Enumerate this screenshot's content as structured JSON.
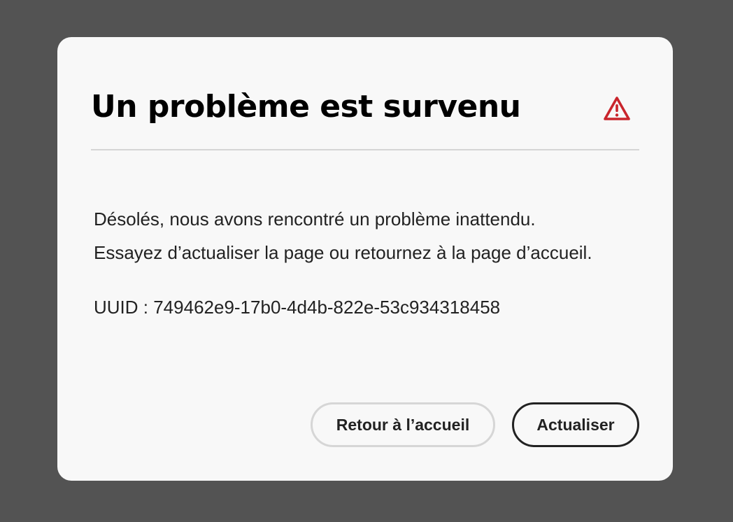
{
  "dialog": {
    "title": "Un problème est survenu",
    "icon": "warning-triangle-icon",
    "icon_color": "#c9252c",
    "message_line_1": "Désolés, nous avons rencontré un problème inattendu.",
    "message_line_2": "Essayez d’actualiser la page ou retournez à la page d’accueil.",
    "uuid": "UUID : 749462e9-17b0-4d4b-822e-53c934318458",
    "buttons": {
      "home_label": "Retour à l’accueil",
      "refresh_label": "Actualiser"
    }
  }
}
